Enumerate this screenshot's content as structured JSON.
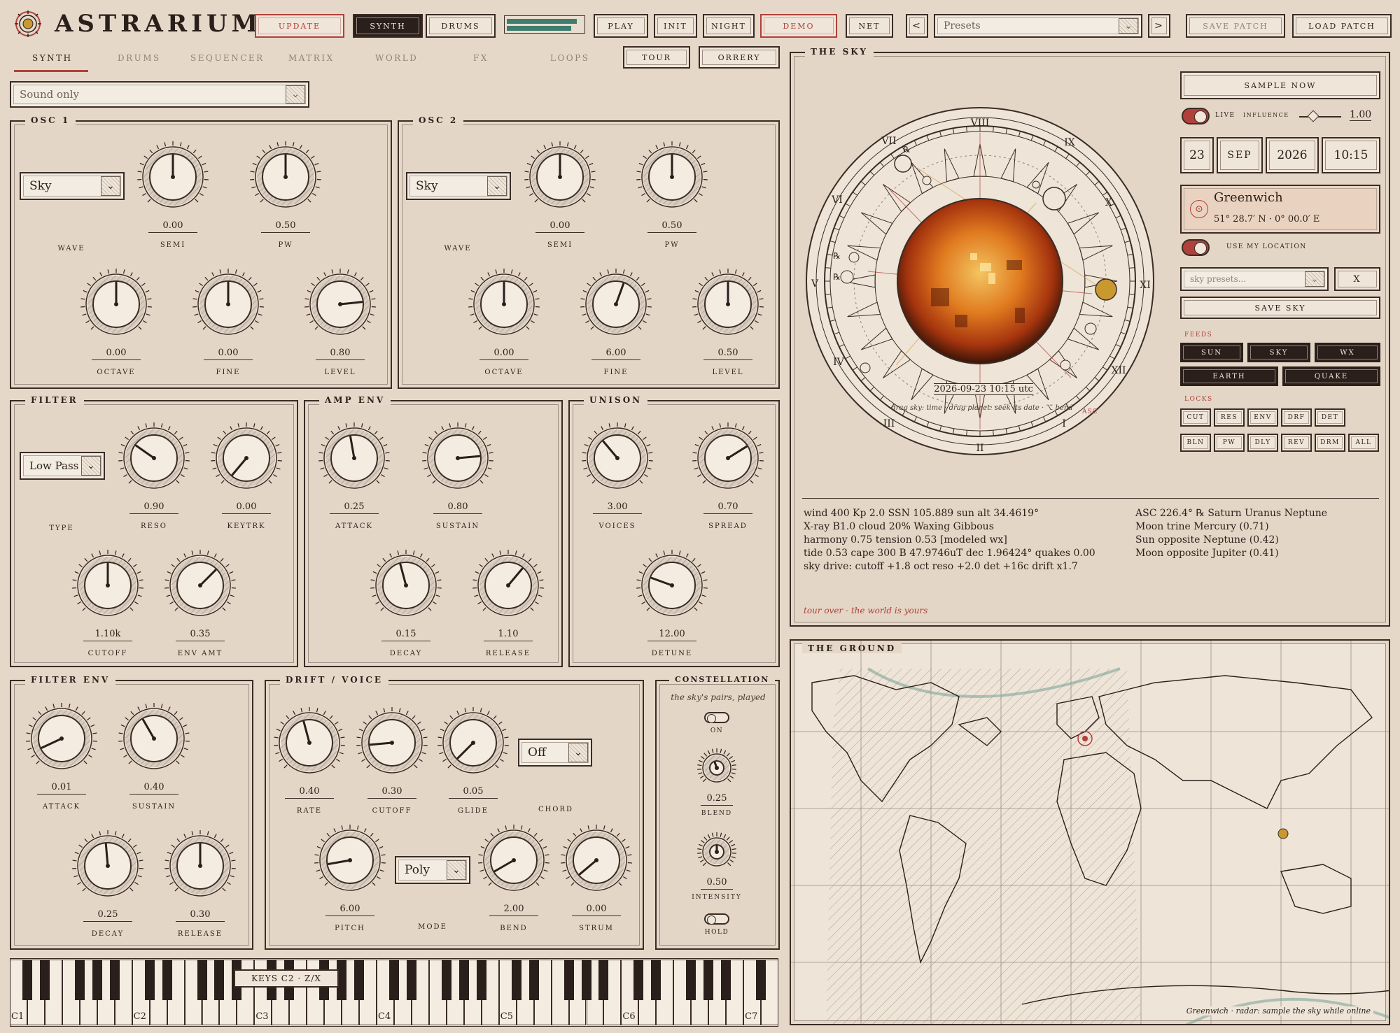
{
  "app": {
    "title": "ASTRARIUM"
  },
  "topbar": {
    "update": "UPDATE",
    "synth": "SYNTH",
    "drums": "DRUMS",
    "play": "PLAY",
    "init": "INIT",
    "night": "NIGHT",
    "demo": "DEMO",
    "net": "NET",
    "prev": "<",
    "presets": "Presets",
    "next": ">",
    "save_patch": "SAVE PATCH",
    "load_patch": "LOAD PATCH"
  },
  "tabs": [
    "SYNTH",
    "DRUMS",
    "SEQUENCER",
    "MATRIX",
    "WORLD",
    "FX",
    "LOOPS"
  ],
  "tour": "TOUR",
  "orrery": "ORRERY",
  "mode_select": "Sound only",
  "osc1": {
    "title": "OSC 1",
    "wave": "Sky",
    "wave_label": "WAVE",
    "semi": "0.00",
    "semi_label": "SEMI",
    "pw": "0.50",
    "pw_label": "PW",
    "octave": "0.00",
    "octave_label": "OCTAVE",
    "fine": "0.00",
    "fine_label": "FINE",
    "level": "0.80",
    "level_label": "LEVEL"
  },
  "osc2": {
    "title": "OSC 2",
    "wave": "Sky",
    "wave_label": "WAVE",
    "semi": "0.00",
    "semi_label": "SEMI",
    "pw": "0.50",
    "pw_label": "PW",
    "octave": "0.00",
    "octave_label": "OCTAVE",
    "fine": "6.00",
    "fine_label": "FINE",
    "level": "0.50",
    "level_label": "LEVEL"
  },
  "filter": {
    "title": "FILTER",
    "type": "Low Pass",
    "type_label": "TYPE",
    "reso": "0.90",
    "reso_label": "RESO",
    "keytrk": "0.00",
    "keytrk_label": "KEYTRK",
    "cutoff": "1.10k",
    "cutoff_label": "CUTOFF",
    "envamt": "0.35",
    "envamt_label": "ENV AMT"
  },
  "ampenv": {
    "title": "AMP ENV",
    "attack": "0.25",
    "attack_label": "ATTACK",
    "sustain": "0.80",
    "sustain_label": "SUSTAIN",
    "decay": "0.15",
    "decay_label": "DECAY",
    "release": "1.10",
    "release_label": "RELEASE"
  },
  "unison": {
    "title": "UNISON",
    "voices": "3.00",
    "voices_label": "VOICES",
    "spread": "0.70",
    "spread_label": "SPREAD",
    "detune": "12.00",
    "detune_label": "DETUNE"
  },
  "filterenv": {
    "title": "FILTER ENV",
    "attack": "0.01",
    "attack_label": "ATTACK",
    "sustain": "0.40",
    "sustain_label": "SUSTAIN",
    "decay": "0.25",
    "decay_label": "DECAY",
    "release": "0.30",
    "release_label": "RELEASE"
  },
  "drift": {
    "title": "DRIFT / VOICE",
    "rate": "0.40",
    "rate_label": "RATE",
    "cutoff": "0.30",
    "cutoff_label": "CUTOFF",
    "glide": "0.05",
    "glide_label": "GLIDE",
    "chord": "Off",
    "chord_label": "CHORD",
    "pitch": "6.00",
    "pitch_label": "PITCH",
    "mode": "Poly",
    "mode_label": "MODE",
    "bend": "2.00",
    "bend_label": "BEND",
    "strum": "0.00",
    "strum_label": "STRUM"
  },
  "constellation": {
    "title": "CONSTELLATION",
    "subtitle": "the sky's pairs, played",
    "on": "ON",
    "blend": "0.25",
    "blend_label": "BLEND",
    "intensity": "0.50",
    "intensity_label": "INTENSITY",
    "hold": "HOLD"
  },
  "keys": {
    "badge": "KEYS C2 · Z/X",
    "labels": [
      "C1",
      "C2",
      "C3",
      "C4",
      "C5",
      "C6",
      "C7"
    ]
  },
  "sky": {
    "title": "THE SKY",
    "sample_now": "SAMPLE NOW",
    "live": "LIVE",
    "influence": "INFLUENCE",
    "influence_value": "1.00",
    "day": "23",
    "month": "SEP",
    "year": "2026",
    "time": "10:15",
    "place": "Greenwich",
    "coords": "51° 28.7′ N · 0° 00.0′ E",
    "use_location": "USE MY LOCATION",
    "sky_presets": "sky presets...",
    "clear": "X",
    "save_sky": "SAVE SKY",
    "feeds_label": "FEEDS",
    "feeds": [
      "SUN",
      "SKY",
      "WX",
      "EARTH",
      "QUAKE"
    ],
    "locks_label": "LOCKS",
    "locks": [
      "CUT",
      "RES",
      "ENV",
      "DRF",
      "DET",
      "BLN",
      "PW",
      "DLY",
      "REV",
      "DRM",
      "ALL"
    ],
    "chart_date": "2026-09-23 10:15 utc",
    "chart_hint": "drag sky: time · drag planet: seek its date · ⌥ bend",
    "asc": "ASC",
    "readout_left": [
      "wind 400  Kp 2.0  SSN 105.889  sun alt 34.4619°",
      "X-ray B1.0  cloud 20%  Waxing Gibbous",
      "harmony 0.75  tension 0.53  [modeled wx]",
      "tide 0.53  cape 300  B 47.9746uT  dec 1.96424°  quakes 0.00",
      "sky drive:  cutoff +1.8 oct   reso +2.0   det +16c   drift x1.7"
    ],
    "readout_right": [
      "ASC 226.4°  ℞ Saturn Uranus Neptune",
      "Moon trine Mercury (0.71)",
      "Sun opposite Neptune (0.42)",
      "Moon opposite Jupiter (0.41)"
    ],
    "tour_note": "tour over - the world is yours"
  },
  "ground": {
    "title": "THE GROUND",
    "footer": "Greenwich · radar: sample the sky while online"
  },
  "colors": {
    "accent": "#b0413a",
    "ink": "#2a1f1a",
    "paper": "#e5d8c9",
    "teal": "#3f7d6e"
  }
}
